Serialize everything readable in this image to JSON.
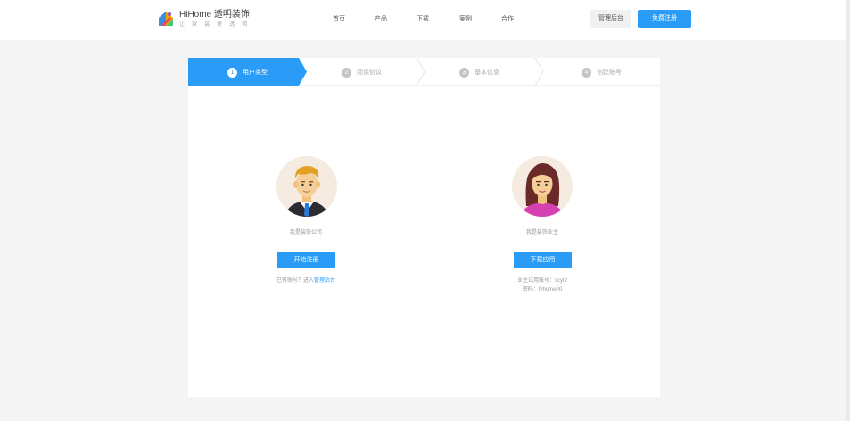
{
  "brand": {
    "title": "HiHome 透明装饰",
    "slogan": "让 家 装 更 透 明"
  },
  "nav": {
    "items": [
      {
        "label": "首页"
      },
      {
        "label": "产品"
      },
      {
        "label": "下载"
      },
      {
        "label": "案例"
      },
      {
        "label": "合作"
      }
    ]
  },
  "header": {
    "admin_label": "管理后台",
    "register_label": "免费注册"
  },
  "steps": [
    {
      "num": "1",
      "label": "用户类型",
      "active": true
    },
    {
      "num": "2",
      "label": "阅读协议",
      "active": false
    },
    {
      "num": "3",
      "label": "基本信息",
      "active": false
    },
    {
      "num": "4",
      "label": "创建账号",
      "active": false
    }
  ],
  "company": {
    "role_text": "我是装饰公司",
    "button_label": "开始注册",
    "note_prefix": "已有账号？进入",
    "note_link": "管理后台"
  },
  "owner": {
    "role_text": "我是装饰业主",
    "button_label": "下载应用",
    "trial_account": "业主试用账号：scyt2",
    "trial_password": "密码：hihome00"
  },
  "colors": {
    "accent": "#2a9cf8",
    "page_bg": "#f4f4f4",
    "inactive_step": "#c4c4c4"
  }
}
